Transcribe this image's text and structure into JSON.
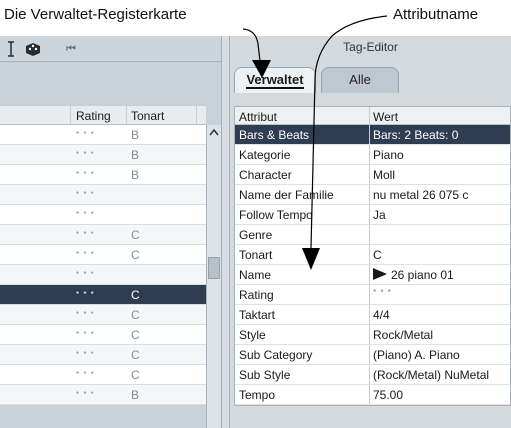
{
  "callouts": {
    "left": "Die Verwaltet-Registerkarte",
    "right": "Attributname"
  },
  "left_pane": {
    "toolbar": {
      "icons": [
        "cursor-icon",
        "dice-icon",
        "skip-back-icon"
      ],
      "skip_glyph": "⏮"
    },
    "columns": [
      "Rating",
      "Tonart"
    ],
    "rows": [
      {
        "rating": "* * *",
        "tonart": "B",
        "selected": false
      },
      {
        "rating": "* * *",
        "tonart": "B",
        "selected": false
      },
      {
        "rating": "* * *",
        "tonart": "B",
        "selected": false
      },
      {
        "rating": "* * *",
        "tonart": "",
        "selected": false
      },
      {
        "rating": "* * *",
        "tonart": "",
        "selected": false
      },
      {
        "rating": "* * *",
        "tonart": "C",
        "selected": false
      },
      {
        "rating": "* * *",
        "tonart": "C",
        "selected": false
      },
      {
        "rating": "* * *",
        "tonart": "",
        "selected": false
      },
      {
        "rating": "* * *",
        "tonart": "C",
        "selected": true
      },
      {
        "rating": "* * *",
        "tonart": "C",
        "selected": false
      },
      {
        "rating": "* * *",
        "tonart": "C",
        "selected": false
      },
      {
        "rating": "* * *",
        "tonart": "C",
        "selected": false
      },
      {
        "rating": "* * *",
        "tonart": "C",
        "selected": false
      },
      {
        "rating": "* * *",
        "tonart": "B",
        "selected": false
      }
    ]
  },
  "tag_editor": {
    "title": "Tag-Editor",
    "tabs": [
      {
        "label": "Verwaltet",
        "active": true
      },
      {
        "label": "Alle",
        "active": false
      }
    ],
    "header": {
      "attribute": "Attribut",
      "value": "Wert"
    },
    "rows": [
      {
        "name": "Bars & Beats",
        "value": "Bars: 2 Beats: 0",
        "selected": true
      },
      {
        "name": "Kategorie",
        "value": "Piano"
      },
      {
        "name": "Character",
        "value": "Moll"
      },
      {
        "name": "Name der Familie",
        "value": "nu metal 26 075 c"
      },
      {
        "name": "Follow Tempo",
        "value": "Ja"
      },
      {
        "name": "Genre",
        "value": ""
      },
      {
        "name": "Tonart",
        "value": "C"
      },
      {
        "name": "Name",
        "value": "26 piano 01",
        "icon": "play-icon"
      },
      {
        "name": "Rating",
        "value": "* * *",
        "is_rating": true
      },
      {
        "name": "Taktart",
        "value": "4/4"
      },
      {
        "name": "Style",
        "value": "Rock/Metal"
      },
      {
        "name": "Sub Category",
        "value": "(Piano) A. Piano"
      },
      {
        "name": "Sub Style",
        "value": "(Rock/Metal) NuMetal"
      },
      {
        "name": "Tempo",
        "value": "75.00"
      }
    ]
  },
  "colors": {
    "selection": "#2f3d52",
    "pane_background": "#c9d1d8"
  }
}
